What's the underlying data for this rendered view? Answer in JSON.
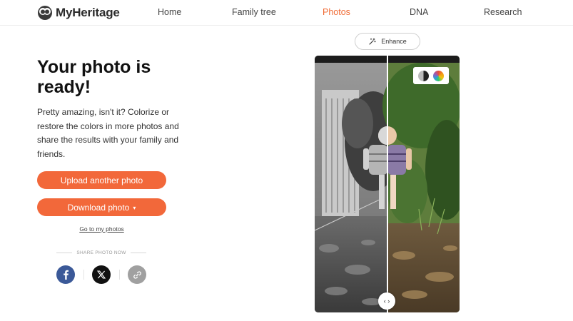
{
  "header": {
    "logo_text": "MyHeritage",
    "nav": [
      {
        "label": "Home",
        "active": false
      },
      {
        "label": "Family tree",
        "active": false
      },
      {
        "label": "Photos",
        "active": true
      },
      {
        "label": "DNA",
        "active": false
      },
      {
        "label": "Research",
        "active": false
      }
    ]
  },
  "main": {
    "title": "Your photo is ready!",
    "description": "Pretty amazing, isn't it? Colorize or restore the colors in more photos and share the results with your family and friends.",
    "upload_button": "Upload another photo",
    "download_button": "Download photo",
    "download_caret": "▾",
    "go_to_photos_link": "Go to my photos",
    "share_label": "SHARE PHOTO NOW",
    "share_buttons": [
      "facebook-icon",
      "x-icon",
      "link-icon"
    ]
  },
  "viewer": {
    "enhance_label": "Enhance",
    "toggle_icons": [
      "black-and-white-icon",
      "color-icon"
    ],
    "handle_icon": "‹ ›"
  },
  "colors": {
    "accent": "#f2683a",
    "nav_active": "#f06a33",
    "facebook": "#3b5998"
  }
}
